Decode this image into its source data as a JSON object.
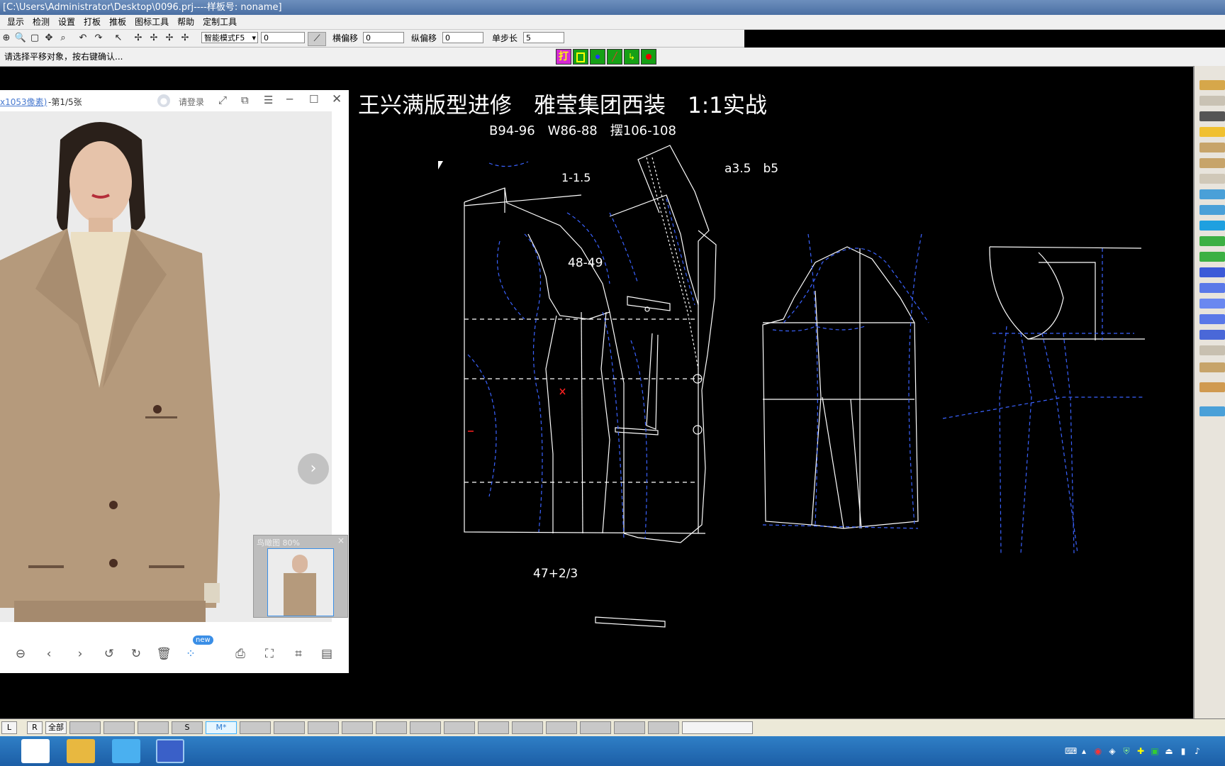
{
  "window": {
    "title": "[C:\\Users\\Administrator\\Desktop\\0096.prj----样板号: noname]"
  },
  "menu": [
    "显示",
    "检测",
    "设置",
    "打板",
    "推板",
    "图标工具",
    "帮助",
    "定制工具"
  ],
  "toolbar": {
    "mode_select": "智能模式F5",
    "value_field": "0",
    "h_offset_label": "横偏移",
    "h_offset_value": "0",
    "v_offset_label": "纵偏移",
    "v_offset_value": "0",
    "step_label": "单步长",
    "step_value": "5"
  },
  "status": {
    "message": "请选择平移对象，按右键确认...",
    "tools": {
      "print_label": "打"
    }
  },
  "canvas": {
    "heading": "王兴满版型进修　雅莹集团西装　1:1实战",
    "measurements": "B94-96　W86-88　摆106-108",
    "annotations": {
      "ab": "a3.5　b5",
      "shoulder": "1-1.5",
      "armhole": "48-49",
      "length": "47+2/3"
    }
  },
  "viewer": {
    "file_info": "x1053像素)",
    "page_info": "-第1/5张",
    "login_label": "请登录",
    "thumbnail_label": "鸟瞰图 80%",
    "new_badge": "new"
  },
  "sizebar": {
    "left_btn": "L",
    "right_btn": "R",
    "all_btn": "全部",
    "size_s": "S",
    "size_m": "M*"
  },
  "colors": {
    "pattern_line": "#ffffff",
    "construction_line": "#3a62ff",
    "accent": "#ff2020",
    "background": "#000000"
  }
}
